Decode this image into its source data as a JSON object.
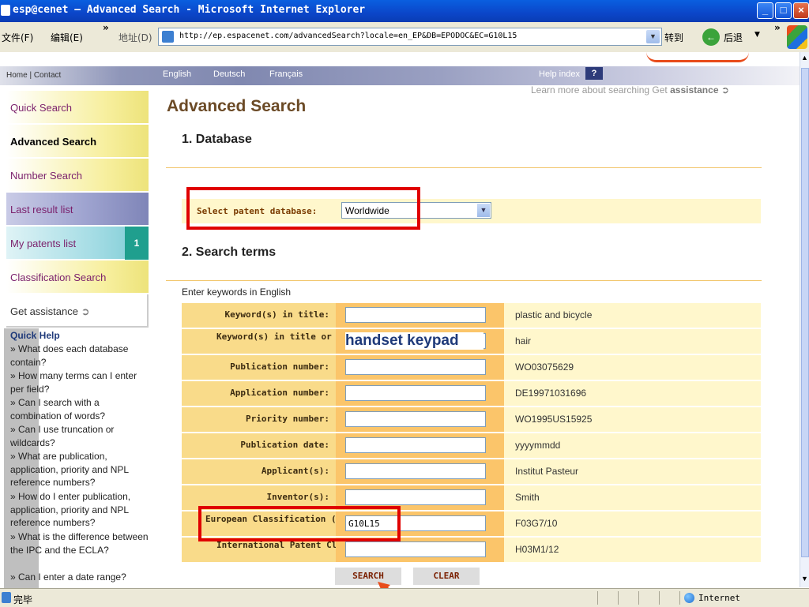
{
  "window": {
    "title": "esp@cenet — Advanced Search - Microsoft Internet Explorer",
    "controls": [
      "minimize",
      "maximize",
      "close"
    ]
  },
  "menu": {
    "file": "文件(F)",
    "edit": "编辑(E)",
    "more": "»",
    "address_label": "地址(D)",
    "url": "http://ep.espacenet.com/advancedSearch?locale=en_EP&DB=EPODOC&EC=G10L15",
    "go": "转到",
    "back": "后退"
  },
  "header": {
    "home_contact": "Home | Contact",
    "languages": [
      "English",
      "Deutsch",
      "Français"
    ],
    "help_index": "Help index",
    "help_q": "?",
    "learn_prefix": "Learn more about searching Get ",
    "learn_link": "assistance"
  },
  "sidebar": {
    "items": [
      {
        "label": "Quick Search"
      },
      {
        "label": "Advanced Search"
      },
      {
        "label": "Number Search"
      },
      {
        "label": "Last result list"
      },
      {
        "label": "My patents list",
        "badge": "1"
      },
      {
        "label": "Classification Search"
      },
      {
        "label": "Get assistance"
      }
    ],
    "quick_help_title": "Quick Help",
    "quick_help": [
      "» What does each database contain?",
      "» How many terms can I enter per field?",
      "» Can I search with a combination of words?",
      "» Can I use truncation or wildcards?",
      "» What are publication, application, priority and NPL reference numbers?",
      "» How do I enter publication, application, priority and NPL reference numbers?",
      "» What is the difference between the IPC and the ECLA?",
      "» Can I enter a date range?"
    ]
  },
  "main": {
    "title": "Advanced Search",
    "section1": "1. Database",
    "db_label": "Select patent database:",
    "db_value": "Worldwide",
    "section2": "2. Search terms",
    "enter_keywords": "Enter keywords in English",
    "fields": [
      {
        "label": "Keyword(s) in title:",
        "value": "",
        "example": "plastic and bicycle"
      },
      {
        "label": "Keyword(s) in title or abstract:",
        "value": "",
        "example": "hair"
      },
      {
        "label": "Publication number:",
        "value": "",
        "example": "WO03075629"
      },
      {
        "label": "Application number:",
        "value": "",
        "example": "DE19971031696"
      },
      {
        "label": "Priority number:",
        "value": "",
        "example": "WO1995US15925"
      },
      {
        "label": "Publication date:",
        "value": "",
        "example": "yyyymmdd"
      },
      {
        "label": "Applicant(s):",
        "value": "",
        "example": "Institut Pasteur"
      },
      {
        "label": "Inventor(s):",
        "value": "",
        "example": "Smith"
      },
      {
        "label": "European Classification (ECLA):",
        "value": "G10L15",
        "example": "F03G7/10"
      },
      {
        "label": "International Patent Classification (IPC):",
        "value": "",
        "example": "H03M1/12"
      }
    ],
    "overlay_text": "handset keypad",
    "search_button": "SEARCH",
    "clear_button": "CLEAR"
  },
  "status": {
    "left": "完毕",
    "zone": "Internet"
  },
  "colors": {
    "titlebar": "#0b46c9",
    "heading": "#6b4a26",
    "annotation_red": "#e00000",
    "input_column": "#fbc56a"
  }
}
